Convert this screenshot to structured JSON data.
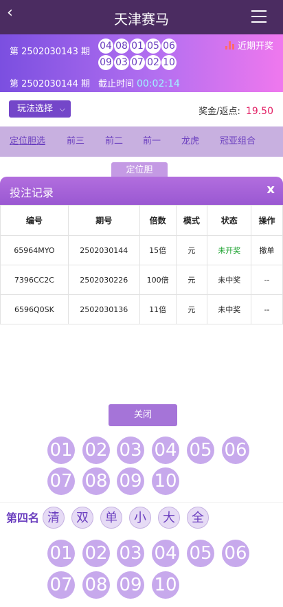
{
  "header": {
    "title": "天津赛马",
    "back_icon": "chevron-left-icon",
    "menu_icon": "hamburger-icon"
  },
  "draw": {
    "prev_issue": "第 2502030143 期",
    "numbers": [
      "04",
      "08",
      "01",
      "05",
      "06",
      "09",
      "03",
      "07",
      "02",
      "10"
    ],
    "history_label": "近期开奖",
    "next_issue": "第 2502030144 期",
    "deadline_label": "截止时间",
    "countdown": "00:02:14"
  },
  "play": {
    "select_label": "玩法选择",
    "bonus_label": "奖金/返点:",
    "bonus_value": "19.50"
  },
  "tabs": [
    "定位胆选",
    "前三",
    "前二",
    "前一",
    "龙虎",
    "冠亚组合"
  ],
  "sub_tab": "定位胆",
  "modal": {
    "title": "投注记录",
    "close_x": "x",
    "columns": [
      "编号",
      "期号",
      "倍数",
      "模式",
      "状态",
      "操作"
    ],
    "rows": [
      {
        "id": "65964MYO",
        "issue": "2502030144",
        "multiple": "15倍",
        "mode": "元",
        "status": "未开奖",
        "action": "撤单"
      },
      {
        "id": "7396CC2C",
        "issue": "2502030226",
        "multiple": "100倍",
        "mode": "元",
        "status": "未中奖",
        "action": "--"
      },
      {
        "id": "6596Q0SK",
        "issue": "2502030136",
        "multiple": "11倍",
        "mode": "元",
        "status": "未中奖",
        "action": "--"
      }
    ],
    "close_button": "关闭"
  },
  "picker": {
    "upper_balls": [
      "01",
      "02",
      "03",
      "04",
      "05",
      "06",
      "07",
      "08",
      "09",
      "10"
    ],
    "rank_label": "第四名",
    "quick_chips": [
      "清",
      "双",
      "单",
      "小",
      "大",
      "全"
    ],
    "lower_balls": [
      "01",
      "02",
      "03",
      "04",
      "05",
      "06",
      "07",
      "08",
      "09",
      "10"
    ]
  },
  "colors": {
    "header_bg": "#4b2c61",
    "accent": "#7446c9",
    "bonus_value": "#e21e63",
    "ball": "#c7a9ec",
    "status_open": "#16a02a"
  }
}
